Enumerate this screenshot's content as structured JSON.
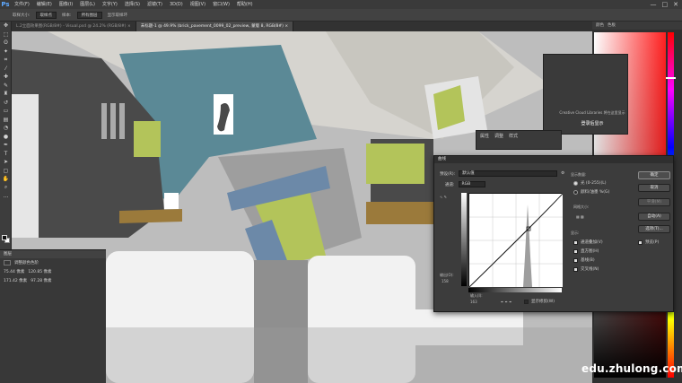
{
  "menubar": {
    "logo": "Ps",
    "items": [
      "文件(F)",
      "编辑(E)",
      "图像(I)",
      "图层(L)",
      "文字(Y)",
      "选择(S)",
      "滤镜(T)",
      "3D(D)",
      "视图(V)",
      "窗口(W)",
      "帮助(H)"
    ],
    "win_controls": [
      "—",
      "□",
      "✕"
    ]
  },
  "options": {
    "tool_size_label": "取样大小:",
    "tool_size_value": "取样点",
    "sample_label": "样本:",
    "sample_value": "所有图层",
    "ring_label": "显示取样环"
  },
  "tabs": [
    "L.2立面效果图(RGB/8#) - Visual.psd @ 24.2% (RGB/8#) ×",
    "未标题-1 @ 49.9% (brick_pavement_0099_02_preview, 蒙版 8, RGB/8#) ×"
  ],
  "right_panels": {
    "tabs": [
      "颜色",
      "色板"
    ],
    "libraries_text": "Creative Cloud Libraries 将在这里显示",
    "libraries_title": "登录后显示"
  },
  "props_panel": {
    "tabs": [
      "属性",
      "调整",
      "样式"
    ]
  },
  "layers_panel": {
    "title": "图层",
    "subtitle": "调整颜色色阶",
    "rows": [
      {
        "a": "75.44 像素",
        "b": "120.85 像素"
      },
      {
        "a": "171.42 像素",
        "b": "97.28 像素"
      }
    ]
  },
  "curves": {
    "title": "曲线",
    "preset_label": "预设(R):",
    "preset_value": "默认值",
    "channel_label": "通道:",
    "channel_value": "RGB",
    "output_label": "输出(O):",
    "output_value": "158",
    "input_label": "输入(I):",
    "input_value": "163",
    "show_clipping": "显示修剪(W)",
    "display_amount_title": "显示数量:",
    "option_light": "光 (0-255)(L)",
    "option_pigment": "颜料/油墨 %(G)",
    "grid_size_title": "网格大小:",
    "show_title": "显示:",
    "show_options": [
      "通道叠加(V)",
      "直方图(H)",
      "基线(B)",
      "交叉线(N)"
    ],
    "buttons": [
      "确定",
      "取消",
      "平滑(M)",
      "自动(A)",
      "选项(T)..."
    ],
    "preview_label": "预览(P)"
  },
  "watermark": "edu.zhulong.com",
  "colors": {
    "teal": "#5b8996",
    "lime": "#b3c45a",
    "dark_shape": "#4a4a4a",
    "ground": "#bdbdbd",
    "paving_brown": "#9b7a3b"
  }
}
